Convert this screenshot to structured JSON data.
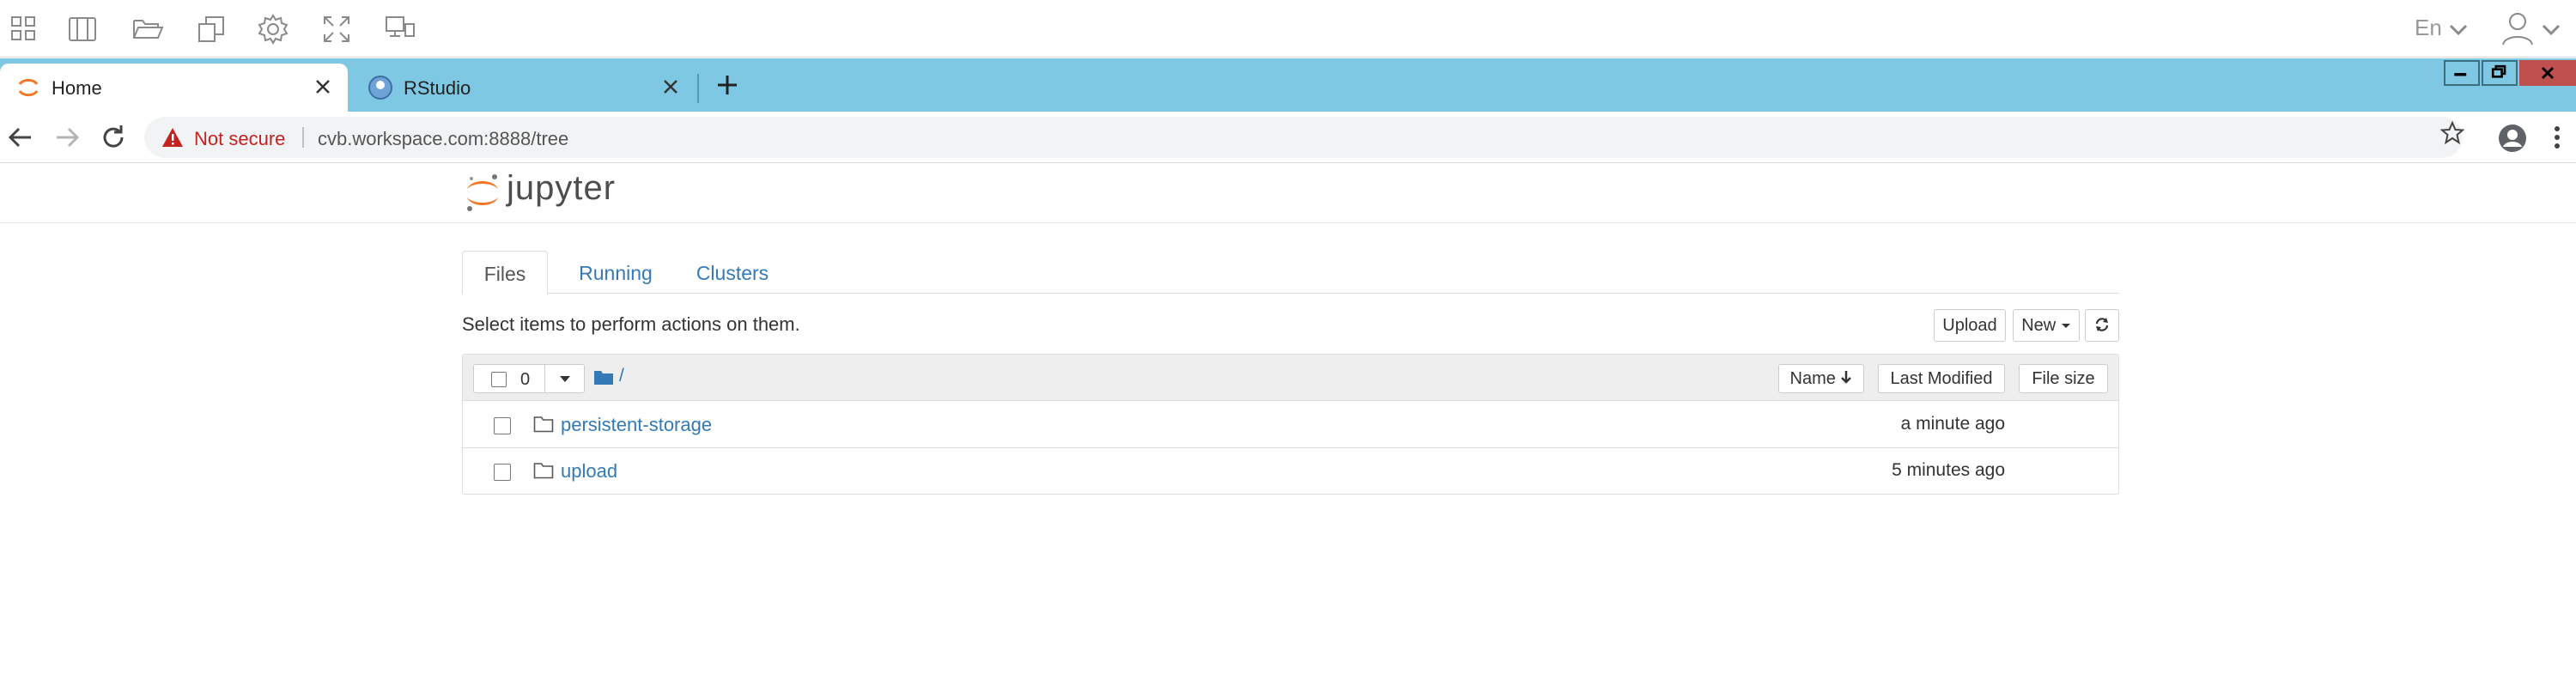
{
  "remote_toolbar": {
    "icons": [
      "apps-grid-icon",
      "split-panel-icon",
      "folder-open-icon",
      "copy-icon",
      "settings-gear-icon",
      "fullscreen-icon",
      "display-icon"
    ],
    "language_label": "En"
  },
  "browser": {
    "tabs": [
      {
        "title": "Home",
        "active": true
      },
      {
        "title": "RStudio",
        "active": false
      }
    ],
    "security_label": "Not secure",
    "url": "cvb.workspace.com:8888/tree"
  },
  "jupyter": {
    "logo_text": "jupyter",
    "tabs": [
      {
        "label": "Files",
        "active": true
      },
      {
        "label": "Running",
        "active": false
      },
      {
        "label": "Clusters",
        "active": false
      }
    ],
    "select_hint": "Select items to perform actions on them.",
    "upload_label": "Upload",
    "new_label": "New",
    "selected_count": "0",
    "breadcrumb": "/",
    "columns": {
      "name": "Name",
      "last_modified": "Last Modified",
      "file_size": "File size"
    },
    "files": [
      {
        "name": "persistent-storage",
        "modified": "a minute ago",
        "type": "folder"
      },
      {
        "name": "upload",
        "modified": "5 minutes ago",
        "type": "folder"
      }
    ]
  },
  "colors": {
    "tabstrip": "#7ec8e3",
    "link": "#337ab7",
    "jupyter_orange": "#f37726",
    "not_secure_red": "#c5221f",
    "close_button": "#c0504d"
  }
}
